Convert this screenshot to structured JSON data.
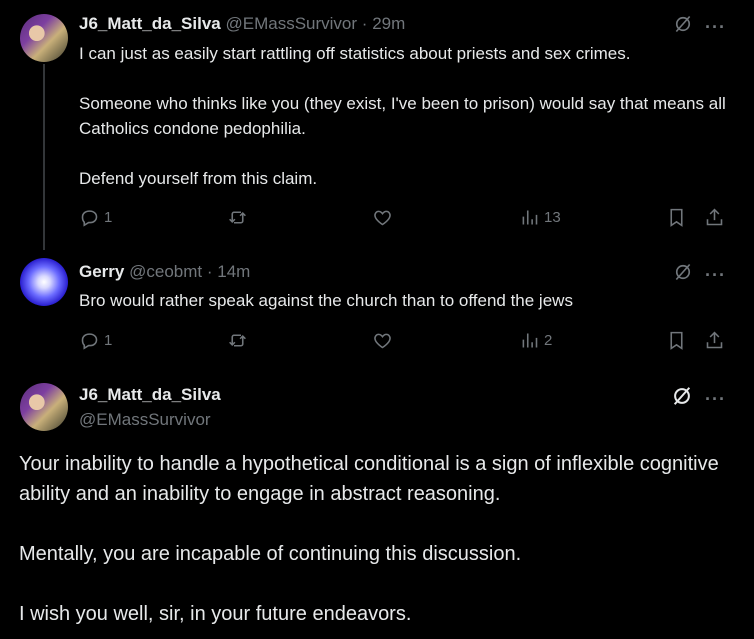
{
  "posts": [
    {
      "display_name": "J6_Matt_da_Silva",
      "handle": "@EMassSurvivor",
      "dot": "·",
      "time": "29m",
      "text": "I can just as easily start rattling off statistics about priests and sex crimes.\n\nSomeone who thinks like you (they exist, I've been to prison) would say that means all Catholics condone pedophilia.\n\nDefend yourself from this claim.",
      "replies": "1",
      "views": "13"
    },
    {
      "display_name": "Gerry",
      "handle": "@ceobmt",
      "dot": "·",
      "time": "14m",
      "text": "Bro would rather speak against the church than to offend the jews",
      "replies": "1",
      "views": "2"
    }
  ],
  "main_post": {
    "display_name": "J6_Matt_da_Silva",
    "handle": "@EMassSurvivor",
    "text": "Your inability to handle a hypothetical conditional is a sign of inflexible cognitive ability and an inability to engage in abstract reasoning.\n\nMentally, you are incapable of continuing this discussion.\n\nI wish you well, sir, in your future endeavors."
  },
  "icons": {
    "grok": "grok-icon",
    "more": "more-icon",
    "reply": "reply-icon",
    "repost": "repost-icon",
    "like": "like-icon",
    "views": "views-icon",
    "bookmark": "bookmark-icon",
    "share": "share-icon"
  },
  "colors": {
    "background": "#000000",
    "text": "#e7e9ea",
    "muted": "#71767b"
  }
}
